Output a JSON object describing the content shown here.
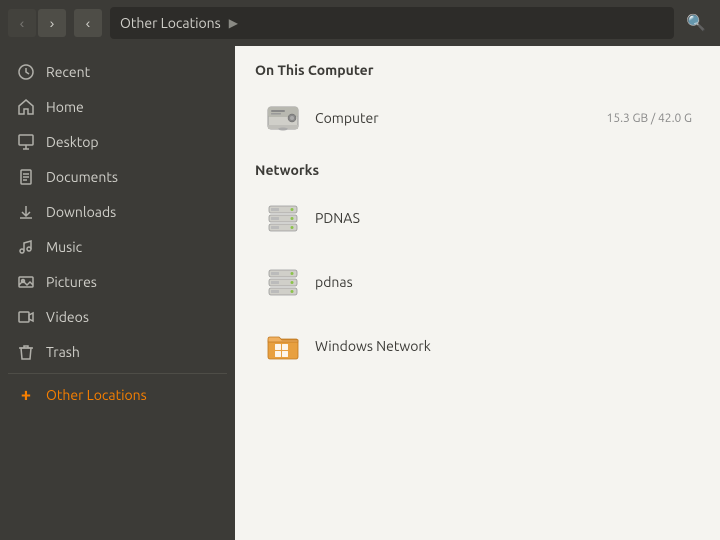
{
  "titlebar": {
    "back_label": "‹",
    "forward_label": "›",
    "breadcrumb": "Other Locations",
    "breadcrumb_arrow": "▶",
    "search_icon": "search-icon"
  },
  "sidebar": {
    "items": [
      {
        "id": "recent",
        "label": "Recent",
        "icon": "clock"
      },
      {
        "id": "home",
        "label": "Home",
        "icon": "home"
      },
      {
        "id": "desktop",
        "label": "Desktop",
        "icon": "folder"
      },
      {
        "id": "documents",
        "label": "Documents",
        "icon": "document"
      },
      {
        "id": "downloads",
        "label": "Downloads",
        "icon": "download"
      },
      {
        "id": "music",
        "label": "Music",
        "icon": "music"
      },
      {
        "id": "pictures",
        "label": "Pictures",
        "icon": "pictures"
      },
      {
        "id": "videos",
        "label": "Videos",
        "icon": "videos"
      },
      {
        "id": "trash",
        "label": "Trash",
        "icon": "trash"
      }
    ],
    "add_label": "Other Locations"
  },
  "content": {
    "on_this_computer_title": "On This Computer",
    "networks_title": "Networks",
    "computer": {
      "name": "Computer",
      "size": "15.3 GB / 42.0 G"
    },
    "network_items": [
      {
        "id": "pdnas-upper",
        "name": "PDNAS"
      },
      {
        "id": "pdnas-lower",
        "name": "pdnas"
      },
      {
        "id": "windows",
        "name": "Windows Network"
      }
    ]
  }
}
